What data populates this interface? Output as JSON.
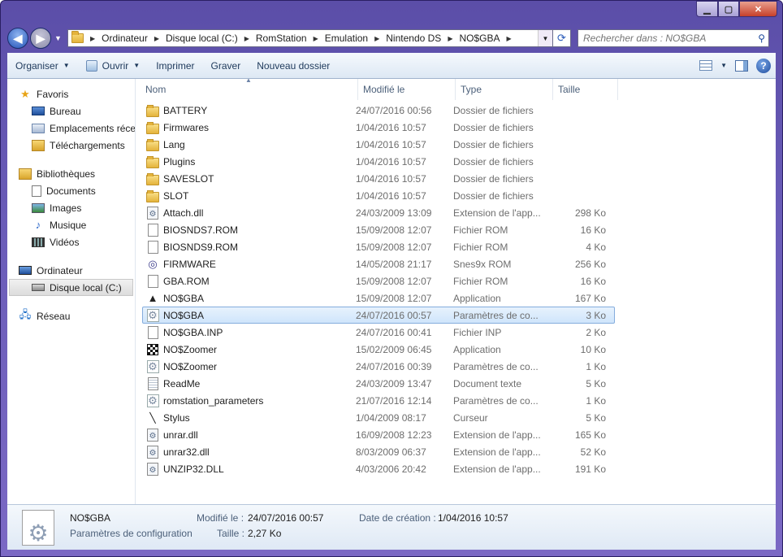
{
  "window": {
    "controls": {
      "minimize": "▁",
      "maximize": "▢",
      "close": "✕"
    }
  },
  "address_bar": {
    "crumbs": [
      "Ordinateur",
      "Disque local (C:)",
      "RomStation",
      "Emulation",
      "Nintendo DS",
      "NO$GBA"
    ],
    "separator": "▶"
  },
  "search": {
    "placeholder": "Rechercher dans : NO$GBA"
  },
  "toolbar": {
    "organise": "Organiser",
    "open": "Ouvrir",
    "print": "Imprimer",
    "burn": "Graver",
    "new_folder": "Nouveau dossier"
  },
  "nav": {
    "favorites": {
      "title": "Favoris",
      "items": [
        "Bureau",
        "Emplacements récents",
        "Téléchargements"
      ]
    },
    "libraries": {
      "title": "Bibliothèques",
      "items": [
        "Documents",
        "Images",
        "Musique",
        "Vidéos"
      ]
    },
    "computer": {
      "title": "Ordinateur",
      "items": [
        "Disque local (C:)"
      ]
    },
    "network": {
      "title": "Réseau"
    }
  },
  "columns": {
    "name": "Nom",
    "modified": "Modifié le",
    "type": "Type",
    "size": "Taille"
  },
  "files": [
    {
      "name": "BATTERY",
      "modified": "24/07/2016 00:56",
      "type": "Dossier de fichiers",
      "size": "",
      "icon": "folder"
    },
    {
      "name": "Firmwares",
      "modified": "1/04/2016 10:57",
      "type": "Dossier de fichiers",
      "size": "",
      "icon": "folder"
    },
    {
      "name": "Lang",
      "modified": "1/04/2016 10:57",
      "type": "Dossier de fichiers",
      "size": "",
      "icon": "folder"
    },
    {
      "name": "Plugins",
      "modified": "1/04/2016 10:57",
      "type": "Dossier de fichiers",
      "size": "",
      "icon": "folder"
    },
    {
      "name": "SAVESLOT",
      "modified": "1/04/2016 10:57",
      "type": "Dossier de fichiers",
      "size": "",
      "icon": "folder"
    },
    {
      "name": "SLOT",
      "modified": "1/04/2016 10:57",
      "type": "Dossier de fichiers",
      "size": "",
      "icon": "folder"
    },
    {
      "name": "Attach.dll",
      "modified": "24/03/2009 13:09",
      "type": "Extension de l'app...",
      "size": "298 Ko",
      "icon": "dll"
    },
    {
      "name": "BIOSNDS7.ROM",
      "modified": "15/09/2008 12:07",
      "type": "Fichier ROM",
      "size": "16 Ko",
      "icon": "doc"
    },
    {
      "name": "BIOSNDS9.ROM",
      "modified": "15/09/2008 12:07",
      "type": "Fichier ROM",
      "size": "4 Ko",
      "icon": "doc"
    },
    {
      "name": "FIRMWARE",
      "modified": "14/05/2008 21:17",
      "type": "Snes9x ROM",
      "size": "256 Ko",
      "icon": "snes"
    },
    {
      "name": "GBA.ROM",
      "modified": "15/09/2008 12:07",
      "type": "Fichier ROM",
      "size": "16 Ko",
      "icon": "doc"
    },
    {
      "name": "NO$GBA",
      "modified": "15/09/2008 12:07",
      "type": "Application",
      "size": "167 Ko",
      "icon": "app"
    },
    {
      "name": "NO$GBA",
      "modified": "24/07/2016 00:57",
      "type": "Paramètres de co...",
      "size": "3 Ko",
      "icon": "cfg",
      "selected": true
    },
    {
      "name": "NO$GBA.INP",
      "modified": "24/07/2016 00:41",
      "type": "Fichier INP",
      "size": "2 Ko",
      "icon": "doc"
    },
    {
      "name": "NO$Zoomer",
      "modified": "15/02/2009 06:45",
      "type": "Application",
      "size": "10 Ko",
      "icon": "zoom"
    },
    {
      "name": "NO$Zoomer",
      "modified": "24/07/2016 00:39",
      "type": "Paramètres de co...",
      "size": "1 Ko",
      "icon": "cfg"
    },
    {
      "name": "ReadMe",
      "modified": "24/03/2009 13:47",
      "type": "Document texte",
      "size": "5 Ko",
      "icon": "text"
    },
    {
      "name": "romstation_parameters",
      "modified": "21/07/2016 12:14",
      "type": "Paramètres de co...",
      "size": "1 Ko",
      "icon": "cfg"
    },
    {
      "name": "Stylus",
      "modified": "1/04/2009 08:17",
      "type": "Curseur",
      "size": "5 Ko",
      "icon": "cursor"
    },
    {
      "name": "unrar.dll",
      "modified": "16/09/2008 12:23",
      "type": "Extension de l'app...",
      "size": "165 Ko",
      "icon": "dll"
    },
    {
      "name": "unrar32.dll",
      "modified": "8/03/2009 06:37",
      "type": "Extension de l'app...",
      "size": "52 Ko",
      "icon": "dll"
    },
    {
      "name": "UNZIP32.DLL",
      "modified": "4/03/2006 20:42",
      "type": "Extension de l'app...",
      "size": "191 Ko",
      "icon": "dll"
    }
  ],
  "details": {
    "name": "NO$GBA",
    "type": "Paramètres de configuration",
    "modified_label": "Modifié le :",
    "modified_value": "24/07/2016 00:57",
    "size_label": "Taille :",
    "size_value": "2,27 Ko",
    "created_label": "Date de création :",
    "created_value": "1/04/2016 10:57"
  }
}
